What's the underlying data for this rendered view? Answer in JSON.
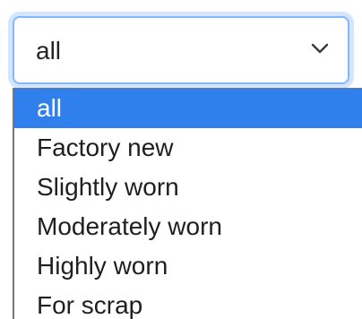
{
  "select": {
    "current_value": "all",
    "icon": "chevron-down-icon"
  },
  "dropdown": {
    "options": [
      {
        "label": "all",
        "selected": true
      },
      {
        "label": "Factory new",
        "selected": false
      },
      {
        "label": "Slightly worn",
        "selected": false
      },
      {
        "label": "Moderately worn",
        "selected": false
      },
      {
        "label": "Highly worn",
        "selected": false
      },
      {
        "label": "For scrap",
        "selected": false
      }
    ]
  },
  "colors": {
    "focus_border": "#86b7fe",
    "selected_background": "#2f80ed",
    "text": "#212529"
  }
}
